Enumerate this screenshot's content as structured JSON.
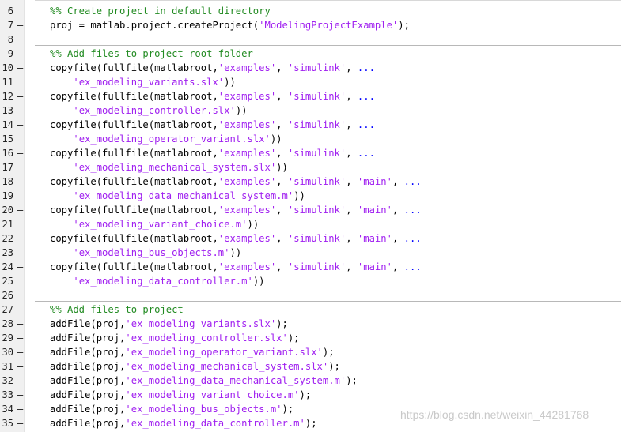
{
  "editor": {
    "language": "MATLAB",
    "lines": [
      {
        "num": "6",
        "mark": "",
        "tokens": [
          [
            "cmt",
            "%% Create project in default directory"
          ]
        ]
      },
      {
        "num": "7",
        "mark": "–",
        "tokens": [
          [
            "",
            "proj = matlab.project.createProject("
          ],
          [
            "str",
            "'ModelingProjectExample'"
          ],
          [
            "",
            ");"
          ]
        ]
      },
      {
        "num": "8",
        "mark": "",
        "tokens": []
      },
      {
        "num": "9",
        "mark": "",
        "tokens": [
          [
            "cmt",
            "%% Add files to project root folder"
          ]
        ]
      },
      {
        "num": "10",
        "mark": "–",
        "tokens": [
          [
            "",
            "copyfile(fullfile(matlabroot,"
          ],
          [
            "str",
            "'examples'"
          ],
          [
            "",
            ", "
          ],
          [
            "str",
            "'simulink'"
          ],
          [
            "",
            ", "
          ],
          [
            "ell",
            "..."
          ]
        ]
      },
      {
        "num": "11",
        "mark": "",
        "tokens": [
          [
            "",
            "    "
          ],
          [
            "str",
            "'ex_modeling_variants.slx'"
          ],
          [
            "",
            "))"
          ]
        ]
      },
      {
        "num": "12",
        "mark": "–",
        "tokens": [
          [
            "",
            "copyfile(fullfile(matlabroot,"
          ],
          [
            "str",
            "'examples'"
          ],
          [
            "",
            ", "
          ],
          [
            "str",
            "'simulink'"
          ],
          [
            "",
            ", "
          ],
          [
            "ell",
            "..."
          ]
        ]
      },
      {
        "num": "13",
        "mark": "",
        "tokens": [
          [
            "",
            "    "
          ],
          [
            "str",
            "'ex_modeling_controller.slx'"
          ],
          [
            "",
            "))"
          ]
        ]
      },
      {
        "num": "14",
        "mark": "–",
        "tokens": [
          [
            "",
            "copyfile(fullfile(matlabroot,"
          ],
          [
            "str",
            "'examples'"
          ],
          [
            "",
            ", "
          ],
          [
            "str",
            "'simulink'"
          ],
          [
            "",
            ", "
          ],
          [
            "ell",
            "..."
          ]
        ]
      },
      {
        "num": "15",
        "mark": "",
        "tokens": [
          [
            "",
            "    "
          ],
          [
            "str",
            "'ex_modeling_operator_variant.slx'"
          ],
          [
            "",
            "))"
          ]
        ]
      },
      {
        "num": "16",
        "mark": "–",
        "tokens": [
          [
            "",
            "copyfile(fullfile(matlabroot,"
          ],
          [
            "str",
            "'examples'"
          ],
          [
            "",
            ", "
          ],
          [
            "str",
            "'simulink'"
          ],
          [
            "",
            ", "
          ],
          [
            "ell",
            "..."
          ]
        ]
      },
      {
        "num": "17",
        "mark": "",
        "tokens": [
          [
            "",
            "    "
          ],
          [
            "str",
            "'ex_modeling_mechanical_system.slx'"
          ],
          [
            "",
            "))"
          ]
        ]
      },
      {
        "num": "18",
        "mark": "–",
        "tokens": [
          [
            "",
            "copyfile(fullfile(matlabroot,"
          ],
          [
            "str",
            "'examples'"
          ],
          [
            "",
            ", "
          ],
          [
            "str",
            "'simulink'"
          ],
          [
            "",
            ", "
          ],
          [
            "str",
            "'main'"
          ],
          [
            "",
            ", "
          ],
          [
            "ell",
            "..."
          ]
        ]
      },
      {
        "num": "19",
        "mark": "",
        "tokens": [
          [
            "",
            "    "
          ],
          [
            "str",
            "'ex_modeling_data_mechanical_system.m'"
          ],
          [
            "",
            "))"
          ]
        ]
      },
      {
        "num": "20",
        "mark": "–",
        "tokens": [
          [
            "",
            "copyfile(fullfile(matlabroot,"
          ],
          [
            "str",
            "'examples'"
          ],
          [
            "",
            ", "
          ],
          [
            "str",
            "'simulink'"
          ],
          [
            "",
            ", "
          ],
          [
            "str",
            "'main'"
          ],
          [
            "",
            ", "
          ],
          [
            "ell",
            "..."
          ]
        ]
      },
      {
        "num": "21",
        "mark": "",
        "tokens": [
          [
            "",
            "    "
          ],
          [
            "str",
            "'ex_modeling_variant_choice.m'"
          ],
          [
            "",
            "))"
          ]
        ]
      },
      {
        "num": "22",
        "mark": "–",
        "tokens": [
          [
            "",
            "copyfile(fullfile(matlabroot,"
          ],
          [
            "str",
            "'examples'"
          ],
          [
            "",
            ", "
          ],
          [
            "str",
            "'simulink'"
          ],
          [
            "",
            ", "
          ],
          [
            "str",
            "'main'"
          ],
          [
            "",
            ", "
          ],
          [
            "ell",
            "..."
          ]
        ]
      },
      {
        "num": "23",
        "mark": "",
        "tokens": [
          [
            "",
            "    "
          ],
          [
            "str",
            "'ex_modeling_bus_objects.m'"
          ],
          [
            "",
            "))"
          ]
        ]
      },
      {
        "num": "24",
        "mark": "–",
        "tokens": [
          [
            "",
            "copyfile(fullfile(matlabroot,"
          ],
          [
            "str",
            "'examples'"
          ],
          [
            "",
            ", "
          ],
          [
            "str",
            "'simulink'"
          ],
          [
            "",
            ", "
          ],
          [
            "str",
            "'main'"
          ],
          [
            "",
            ", "
          ],
          [
            "ell",
            "..."
          ]
        ]
      },
      {
        "num": "25",
        "mark": "",
        "tokens": [
          [
            "",
            "    "
          ],
          [
            "str",
            "'ex_modeling_data_controller.m'"
          ],
          [
            "",
            "))"
          ]
        ]
      },
      {
        "num": "26",
        "mark": "",
        "tokens": []
      },
      {
        "num": "27",
        "mark": "",
        "tokens": [
          [
            "cmt",
            "%% Add files to project"
          ]
        ]
      },
      {
        "num": "28",
        "mark": "–",
        "tokens": [
          [
            "",
            "addFile(proj,"
          ],
          [
            "str",
            "'ex_modeling_variants.slx'"
          ],
          [
            "",
            ");"
          ]
        ]
      },
      {
        "num": "29",
        "mark": "–",
        "tokens": [
          [
            "",
            "addFile(proj,"
          ],
          [
            "str",
            "'ex_modeling_controller.slx'"
          ],
          [
            "",
            ");"
          ]
        ]
      },
      {
        "num": "30",
        "mark": "–",
        "tokens": [
          [
            "",
            "addFile(proj,"
          ],
          [
            "str",
            "'ex_modeling_operator_variant.slx'"
          ],
          [
            "",
            ");"
          ]
        ]
      },
      {
        "num": "31",
        "mark": "–",
        "tokens": [
          [
            "",
            "addFile(proj,"
          ],
          [
            "str",
            "'ex_modeling_mechanical_system.slx'"
          ],
          [
            "",
            ");"
          ]
        ]
      },
      {
        "num": "32",
        "mark": "–",
        "tokens": [
          [
            "",
            "addFile(proj,"
          ],
          [
            "str",
            "'ex_modeling_data_mechanical_system.m'"
          ],
          [
            "",
            ");"
          ]
        ]
      },
      {
        "num": "33",
        "mark": "–",
        "tokens": [
          [
            "",
            "addFile(proj,"
          ],
          [
            "str",
            "'ex_modeling_variant_choice.m'"
          ],
          [
            "",
            ");"
          ]
        ]
      },
      {
        "num": "34",
        "mark": "–",
        "tokens": [
          [
            "",
            "addFile(proj,"
          ],
          [
            "str",
            "'ex_modeling_bus_objects.m'"
          ],
          [
            "",
            ");"
          ]
        ]
      },
      {
        "num": "35",
        "mark": "–",
        "tokens": [
          [
            "",
            "addFile(proj,"
          ],
          [
            "str",
            "'ex_modeling_data_controller.m'"
          ],
          [
            "",
            ");"
          ]
        ]
      }
    ]
  },
  "colors": {
    "comment": "#228b22",
    "string": "#a020f0",
    "continuation": "#0000ff",
    "code": "#000000",
    "gutter": "#f0f0f0"
  },
  "watermark": {
    "text": "https://blog.csdn.net/weixin_44281768"
  }
}
